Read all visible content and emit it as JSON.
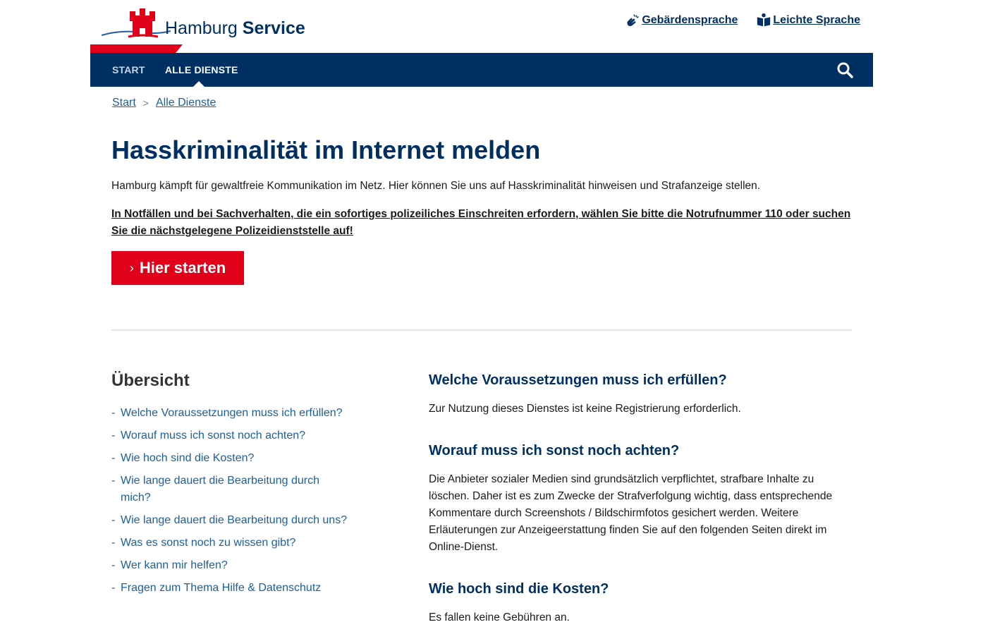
{
  "header": {
    "logo_word_1": "Hamburg",
    "logo_word_2": "Service",
    "links": [
      {
        "label": "Gebärdensprache",
        "icon": "sign-language-icon"
      },
      {
        "label": "Leichte Sprache",
        "icon": "easy-language-book-icon"
      }
    ]
  },
  "nav": {
    "items": [
      "START",
      "ALLE DIENSTE"
    ],
    "search_icon": "search-icon"
  },
  "breadcrumb": {
    "items": [
      "Start",
      "Alle Dienste"
    ],
    "separator": ">"
  },
  "main": {
    "title": "Hasskriminalität im Internet melden",
    "intro": "Hamburg kämpft für gewaltfreie Kommunikation im Netz. Hier können Sie uns auf Hasskriminalität hinweisen und Strafanzeige stellen.",
    "notice": "In Notfällen und bei Sachverhalten, die ein sofortiges polizeiliches Einschreiten erfordern, wählen Sie bitte die Notrufnummer 110 oder suchen Sie die nächstgelegene Polizeidienststelle auf!",
    "cta_label": "Hier starten",
    "cta_icon": "chevron-right-icon"
  },
  "overview": {
    "title": "Übersicht",
    "items": [
      "Welche Voraussetzungen muss ich erfüllen?",
      "Worauf muss ich sonst noch achten?",
      "Wie hoch sind die Kosten?",
      "Wie lange dauert die Bearbeitung durch mich?",
      "Wie lange dauert die Bearbeitung durch uns?",
      "Was es sonst noch zu wissen gibt?",
      "Wer kann mir helfen?",
      "Fragen zum Thema Hilfe & Datenschutz"
    ]
  },
  "sections": [
    {
      "title": "Welche Voraussetzungen muss ich erfüllen?",
      "text": "Zur Nutzung dieses Dienstes ist keine Registrierung erforderlich."
    },
    {
      "title": "Worauf muss ich sonst noch achten?",
      "text": "Die Anbieter sozialer Medien sind grundsätzlich verpflichtet, strafbare Inhalte zu löschen. Daher ist es zum Zwecke der Strafverfolgung wichtig, dass entsprechende Kommentare durch Screenshots / Bildschirmfotos gesichert werden. Weitere Erläuterungen zur Anzeigeerstattung finden Sie auf den folgenden Seiten direkt im Online-Dienst."
    },
    {
      "title": "Wie hoch sind die Kosten?",
      "text": "Es fallen keine Gebühren an."
    }
  ],
  "colors": {
    "brand_blue": "#003063",
    "brand_red": "#e10019",
    "link_blue": "#1d5fa0"
  }
}
